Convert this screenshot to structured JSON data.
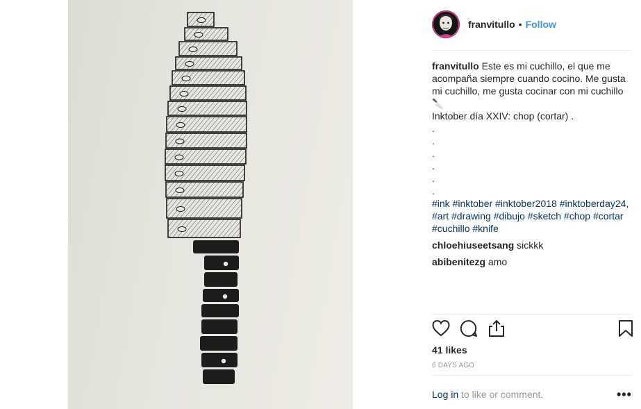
{
  "post": {
    "username": "franvitullo",
    "separator": "•",
    "follow_label": "Follow"
  },
  "caption": {
    "username": "franvitullo",
    "text": "Este es mi cuchillo, el que me acompaña siempre cuando cocino. Me gusta mi cuchillo, me gusta cocinar con mi cuchillo 🔪",
    "line2": "Inktober día XXIV: chop (cortar) .",
    "dots": [
      ".",
      ".",
      ".",
      ".",
      ".",
      "."
    ],
    "hashtags": [
      "#ink",
      "#inktober",
      "#inktober2018",
      "#inktoberday24,",
      "#art",
      "#drawing",
      "#dibujo",
      "#sketch",
      "#chop",
      "#cortar",
      "#cuchillo",
      "#knife"
    ]
  },
  "comments": [
    {
      "username": "chloehiuseetsang",
      "text": "sickkk"
    },
    {
      "username": "abibenitezg",
      "text": "amo"
    }
  ],
  "actions": {
    "like_icon": "heart-icon",
    "comment_icon": "speech-bubble-icon",
    "share_icon": "share-icon",
    "save_icon": "bookmark-icon"
  },
  "likes": "41 likes",
  "time_ago": "6 DAYS AGO",
  "login": {
    "link_label": "Log in",
    "rest": "to like or comment."
  },
  "more_label": "•••"
}
